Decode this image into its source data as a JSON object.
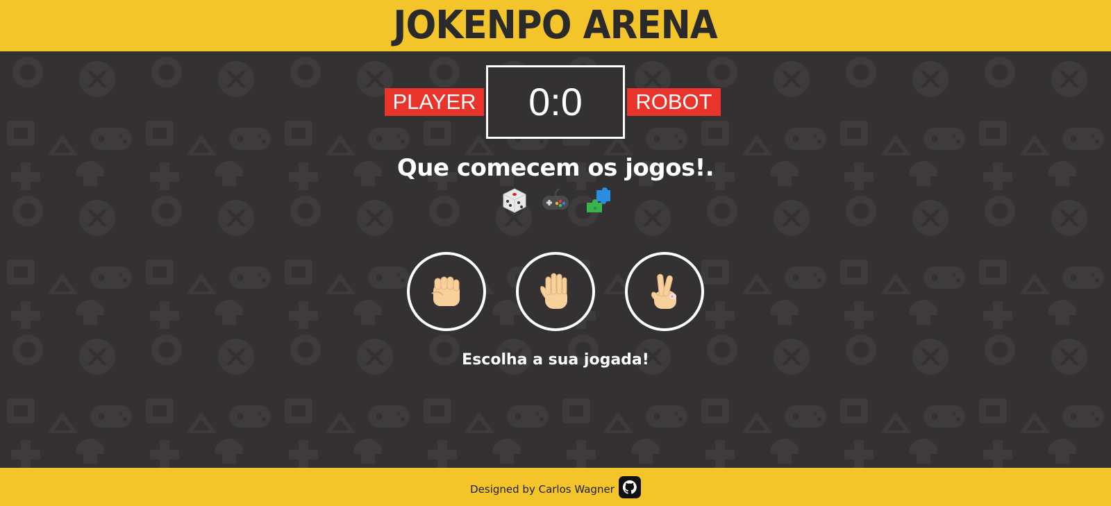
{
  "header": {
    "title": "JOKENPO ARENA"
  },
  "scoreboard": {
    "player_label": "PLAYER",
    "score": "0:0",
    "robot_label": "ROBOT"
  },
  "message": {
    "text": "Que comecem os jogos!.",
    "emojis": [
      "dice-icon",
      "gamepad-icon",
      "puzzle-icon"
    ]
  },
  "choices": [
    {
      "id": "rock",
      "icon": "raised-fist-icon"
    },
    {
      "id": "paper",
      "icon": "raised-hand-icon"
    },
    {
      "id": "scissors",
      "icon": "victory-hand-icon"
    }
  ],
  "prompt": "Escolha a sua jogada!",
  "footer": {
    "credit": "Designed by Carlos Wagner",
    "link_icon": "github-icon"
  },
  "colors": {
    "accent_yellow": "#f4c42b",
    "background": "#333132",
    "label_red": "#e8342a",
    "text": "#ffffff"
  }
}
